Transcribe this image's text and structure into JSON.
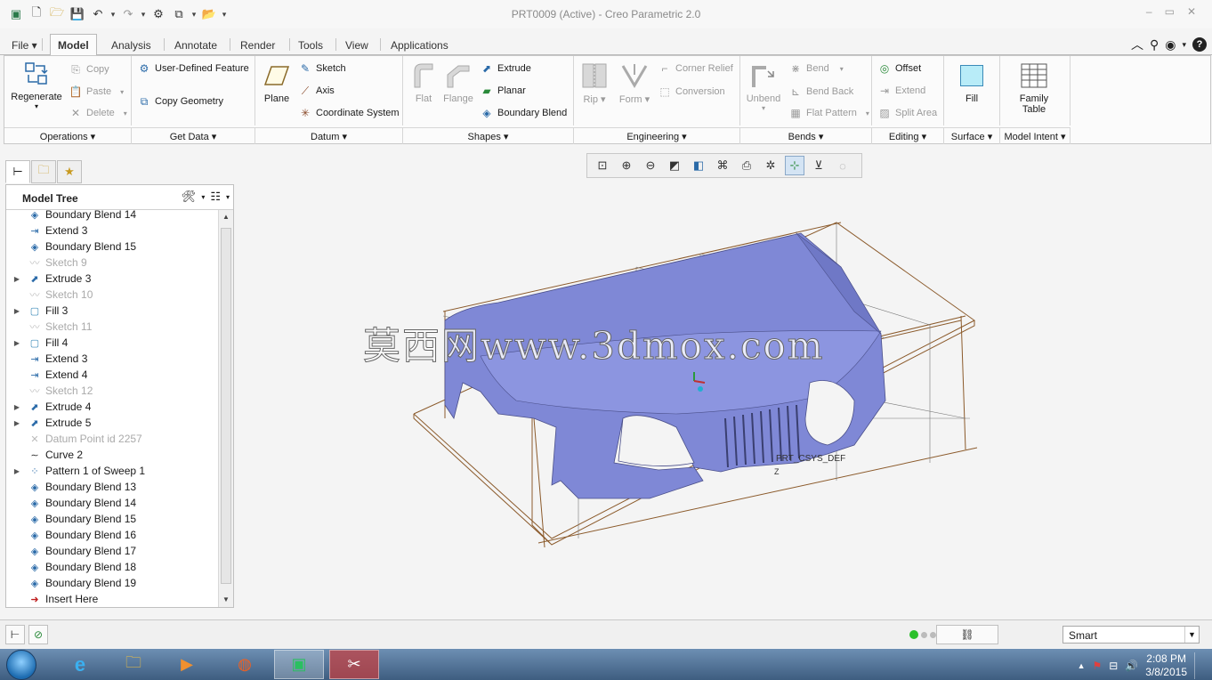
{
  "window": {
    "title": "PRT0009 (Active) - Creo Parametric 2.0",
    "controls": [
      "–",
      "▭",
      "✕"
    ]
  },
  "tabs": [
    "File ▾",
    "Model",
    "Analysis",
    "Annotate",
    "Render",
    "Tools",
    "View",
    "Applications"
  ],
  "ribbon": {
    "operations": {
      "regenerate": "Regenerate",
      "copy": "Copy",
      "paste": "Paste",
      "delete": "Delete",
      "label": "Operations"
    },
    "get_data": {
      "udf": "User-Defined Feature",
      "copy_geometry": "Copy Geometry",
      "label": "Get Data"
    },
    "datum": {
      "plane": "Plane",
      "sketch": "Sketch",
      "axis": "Axis",
      "csys": "Coordinate System",
      "label": "Datum"
    },
    "shapes": {
      "flat": "Flat",
      "flange": "Flange",
      "extrude": "Extrude",
      "planar": "Planar",
      "boundary_blend": "Boundary Blend",
      "label": "Shapes"
    },
    "engineering": {
      "rip": "Rip",
      "form": "Form",
      "corner_relief": "Corner Relief",
      "conversion": "Conversion",
      "label": "Engineering"
    },
    "bends": {
      "unbend": "Unbend",
      "bend": "Bend",
      "bend_back": "Bend Back",
      "flat_pattern": "Flat Pattern",
      "label": "Bends"
    },
    "editing": {
      "offset": "Offset",
      "extend": "Extend",
      "split_area": "Split Area",
      "label": "Editing"
    },
    "surface": {
      "fill": "Fill",
      "label": "Surface"
    },
    "model_intent": {
      "family_table_1": "Family",
      "family_table_2": "Table",
      "label": "Model Intent"
    }
  },
  "model_tree": {
    "title": "Model Tree",
    "items": [
      {
        "label": "Boundary Blend 14",
        "icon": "boundary-blend-icon",
        "expand": "",
        "dim": false
      },
      {
        "label": "Extend 3",
        "icon": "extend-icon",
        "expand": "",
        "dim": false
      },
      {
        "label": "Boundary Blend 15",
        "icon": "boundary-blend-icon",
        "expand": "",
        "dim": false
      },
      {
        "label": "Sketch 9",
        "icon": "sketch-icon",
        "expand": "",
        "dim": true
      },
      {
        "label": "Extrude 3",
        "icon": "extrude-icon",
        "expand": "▶",
        "dim": false
      },
      {
        "label": "Sketch 10",
        "icon": "sketch-icon",
        "expand": "",
        "dim": true
      },
      {
        "label": "Fill 3",
        "icon": "fill-icon",
        "expand": "▶",
        "dim": false
      },
      {
        "label": "Sketch 11",
        "icon": "sketch-icon",
        "expand": "",
        "dim": true
      },
      {
        "label": "Fill 4",
        "icon": "fill-icon",
        "expand": "▶",
        "dim": false
      },
      {
        "label": "Extend 3",
        "icon": "extend-icon",
        "expand": "",
        "dim": false
      },
      {
        "label": "Extend 4",
        "icon": "extend-icon",
        "expand": "",
        "dim": false
      },
      {
        "label": "Sketch 12",
        "icon": "sketch-icon",
        "expand": "",
        "dim": true
      },
      {
        "label": "Extrude 4",
        "icon": "extrude-icon",
        "expand": "▶",
        "dim": false
      },
      {
        "label": "Extrude 5",
        "icon": "extrude-icon",
        "expand": "▶",
        "dim": false
      },
      {
        "label": "Datum Point id 2257",
        "icon": "datum-point-icon",
        "expand": "",
        "dim": true
      },
      {
        "label": "Curve 2",
        "icon": "curve-icon",
        "expand": "",
        "dim": false
      },
      {
        "label": "Pattern 1 of Sweep 1",
        "icon": "pattern-icon",
        "expand": "▶",
        "dim": false
      },
      {
        "label": "Boundary Blend 13",
        "icon": "boundary-blend-icon",
        "expand": "",
        "dim": false
      },
      {
        "label": "Boundary Blend 14",
        "icon": "boundary-blend-icon",
        "expand": "",
        "dim": false
      },
      {
        "label": "Boundary Blend 15",
        "icon": "boundary-blend-icon",
        "expand": "",
        "dim": false
      },
      {
        "label": "Boundary Blend 16",
        "icon": "boundary-blend-icon",
        "expand": "",
        "dim": false
      },
      {
        "label": "Boundary Blend 17",
        "icon": "boundary-blend-icon",
        "expand": "",
        "dim": false
      },
      {
        "label": "Boundary Blend 18",
        "icon": "boundary-blend-icon",
        "expand": "",
        "dim": false
      },
      {
        "label": "Boundary Blend 19",
        "icon": "boundary-blend-icon",
        "expand": "",
        "dim": false
      },
      {
        "label": "Insert Here",
        "icon": "insert-here-icon",
        "expand": "",
        "dim": false
      }
    ]
  },
  "viewport": {
    "watermark": "莫西网www.3dmox.com",
    "csys_label": "PRT_CSYS_DEF",
    "axis_label": "Z"
  },
  "status": {
    "filter": "Smart"
  },
  "taskbar": {
    "time": "2:08 PM",
    "date": "3/8/2015"
  },
  "colors": {
    "part_surface": "#7f88d6",
    "bounding_box": "#8b5a2b",
    "selection_accent": "#3a9a3a"
  }
}
